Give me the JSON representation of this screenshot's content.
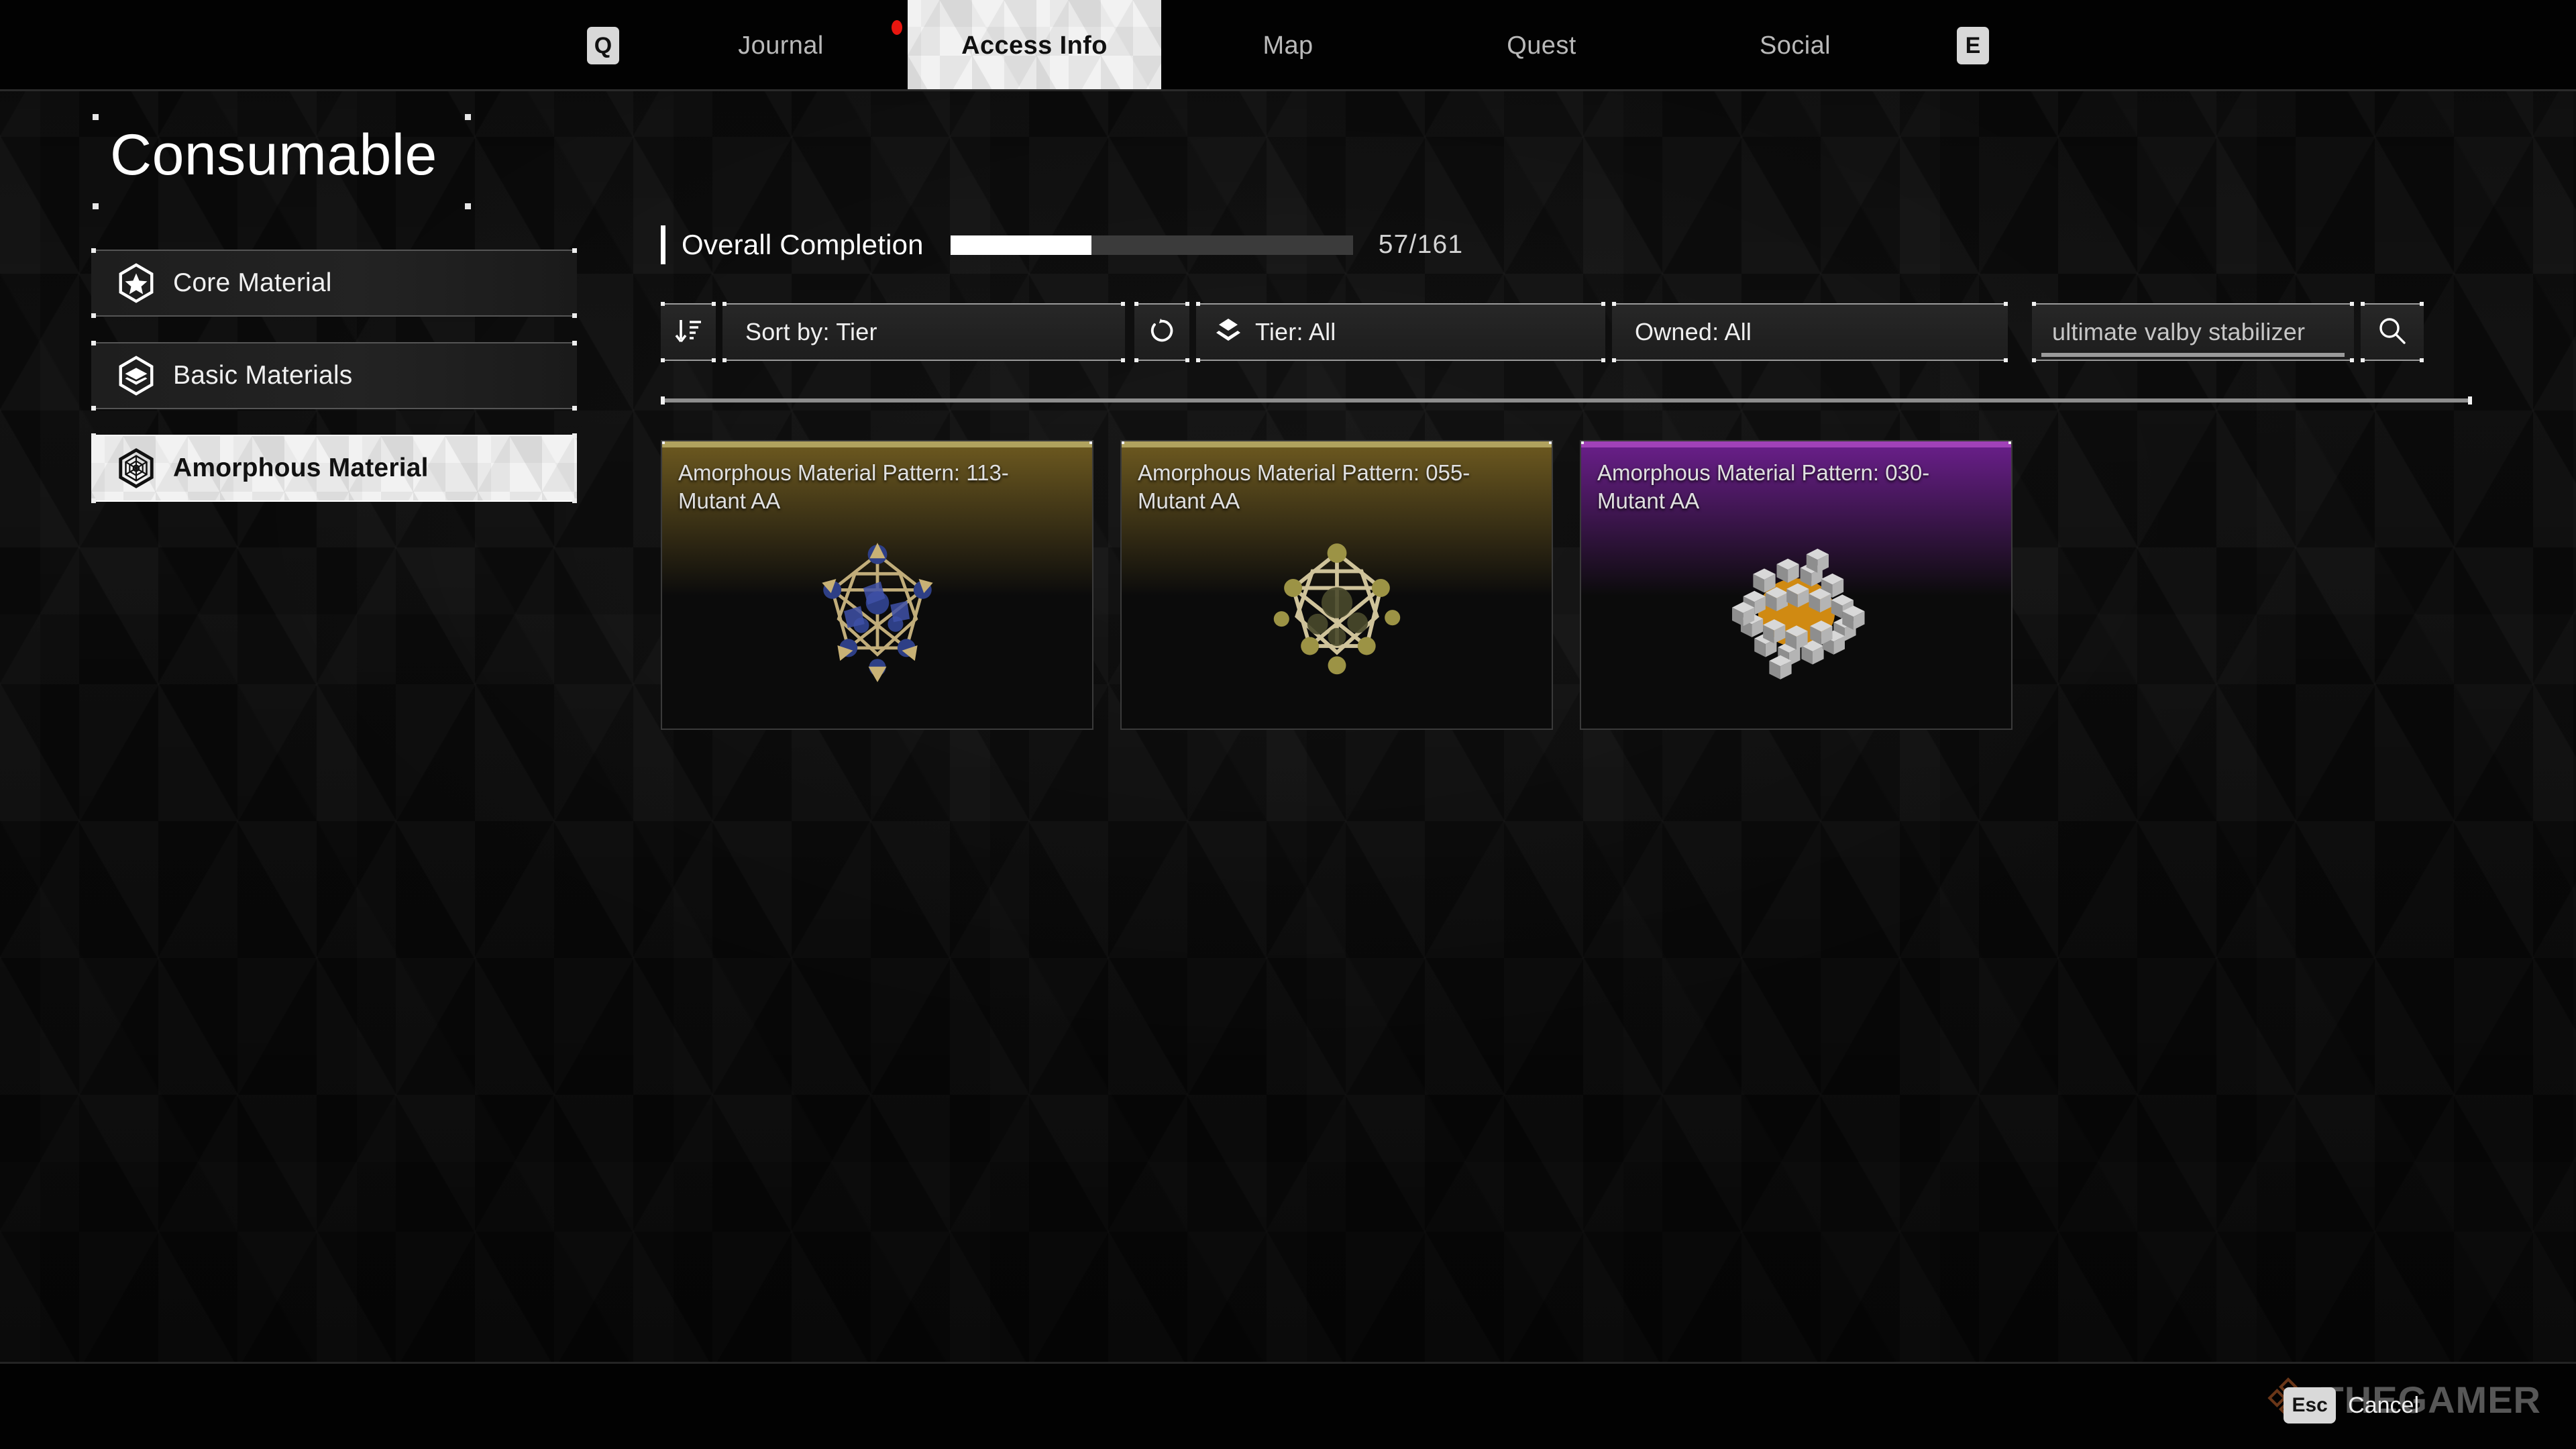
{
  "topnav": {
    "left_key": "Q",
    "right_key": "E",
    "tabs": [
      {
        "label": "Journal",
        "active": false,
        "has_notification": true
      },
      {
        "label": "Access Info",
        "active": true,
        "has_notification": false
      },
      {
        "label": "Map",
        "active": false,
        "has_notification": false
      },
      {
        "label": "Quest",
        "active": false,
        "has_notification": false
      },
      {
        "label": "Social",
        "active": false,
        "has_notification": false
      }
    ]
  },
  "sidebar": {
    "title": "Consumable",
    "items": [
      {
        "label": "Core Material",
        "icon": "hex-star-icon",
        "selected": false
      },
      {
        "label": "Basic Materials",
        "icon": "hex-layers-icon",
        "selected": false
      },
      {
        "label": "Amorphous Material",
        "icon": "hex-lattice-icon",
        "selected": true
      }
    ]
  },
  "completion": {
    "label": "Overall Completion",
    "count_text": "57/161",
    "current": 57,
    "total": 161,
    "percent": 35
  },
  "filters": {
    "sort_icon": "sort-descending-icon",
    "sort_label": "Sort by: Tier",
    "refresh_icon": "refresh-icon",
    "tier_icon": "layers-icon",
    "tier_label": "Tier: All",
    "owned_label": "Owned: All",
    "search_value": "ultimate valby stabilizer",
    "search_icon": "search-icon"
  },
  "cards": [
    {
      "title": "Amorphous Material Pattern: 113-Mutant AA",
      "rarity": "rare-gold",
      "cap_color": "#b0a25e",
      "glow_color": "#6e5a20",
      "art": "lattice-blue"
    },
    {
      "title": "Amorphous Material Pattern: 055-Mutant AA",
      "rarity": "rare-gold",
      "cap_color": "#b0a25e",
      "glow_color": "#6e5a20",
      "art": "lattice-olive"
    },
    {
      "title": "Amorphous Material Pattern: 030-Mutant AA",
      "rarity": "epic-purple",
      "cap_color": "#a041b8",
      "glow_color": "#6b1f8c",
      "art": "cubes-grey"
    }
  ],
  "footer": {
    "esc_key": "Esc",
    "esc_label": "Cancel",
    "watermark": "THEGAMER"
  },
  "colors": {
    "accent_white": "#ffffff",
    "notification_red": "#e8160f",
    "rare_gold": "#b0a25e",
    "epic_purple": "#a041b8",
    "watermark_orange": "#c0622a"
  }
}
